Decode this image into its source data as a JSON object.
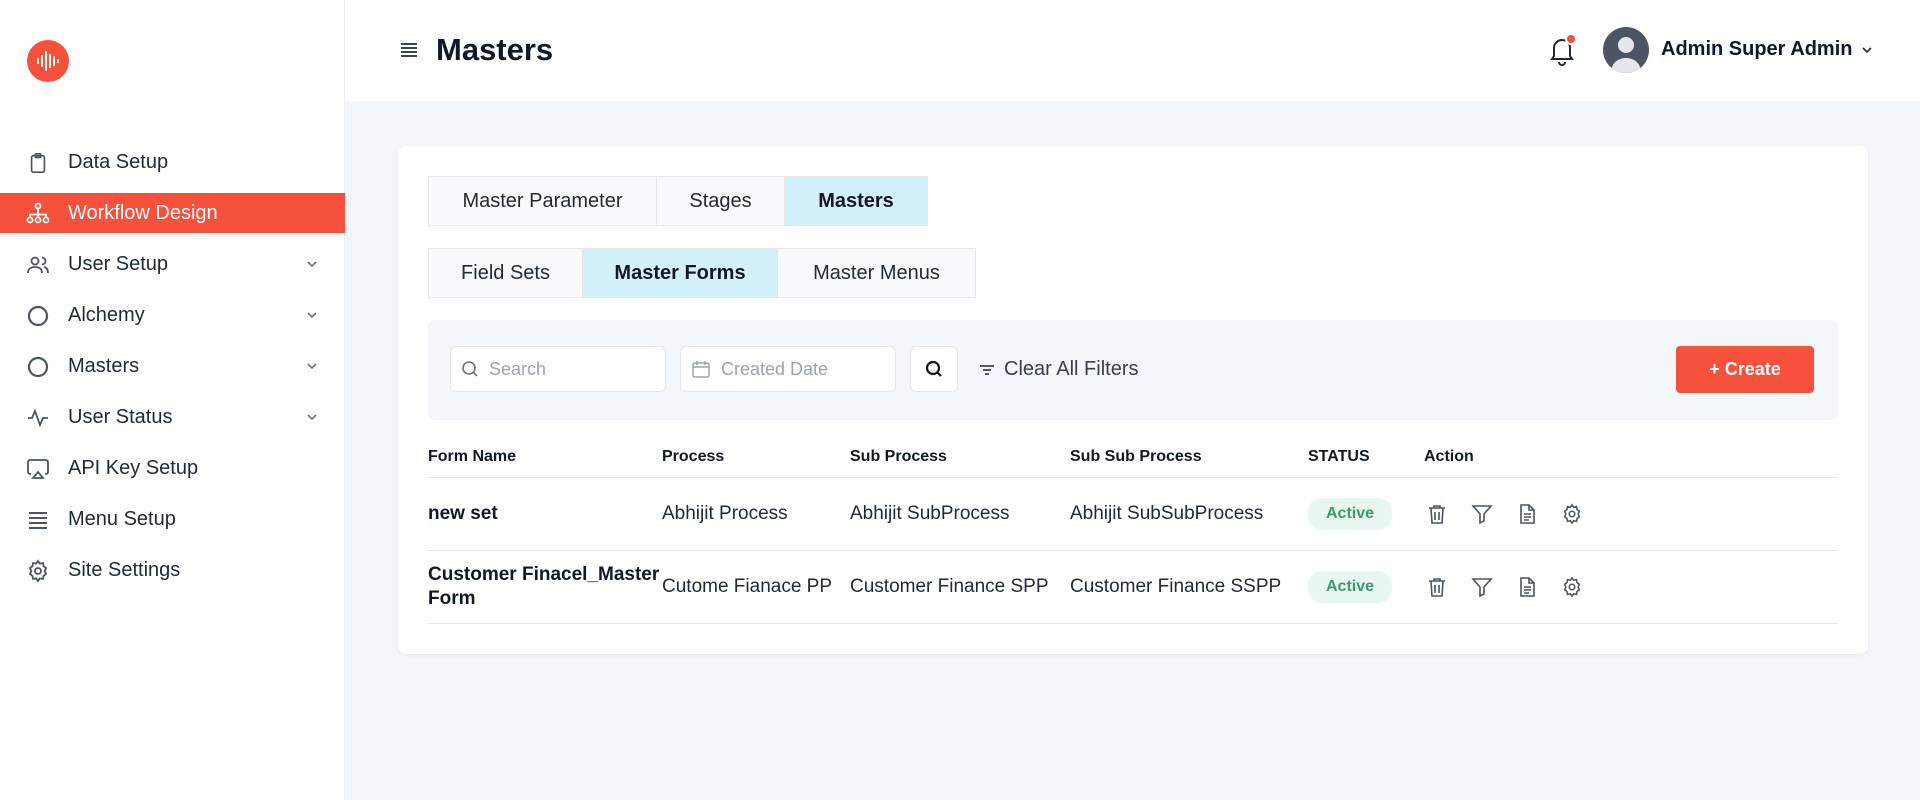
{
  "app": {
    "brand_color": "#f5513d",
    "logo_icon": "audio-wave-icon"
  },
  "sidebar": {
    "items": [
      {
        "label": "Data Setup",
        "icon": "clipboard-icon",
        "has_submenu": false,
        "active": false
      },
      {
        "label": "Workflow Design",
        "icon": "hierarchy-icon",
        "has_submenu": false,
        "active": true
      },
      {
        "label": "User Setup",
        "icon": "users-icon",
        "has_submenu": true,
        "active": false
      },
      {
        "label": "Alchemy",
        "icon": "circle-icon",
        "has_submenu": true,
        "active": false
      },
      {
        "label": "Masters",
        "icon": "circle-icon",
        "has_submenu": true,
        "active": false
      },
      {
        "label": "User Status",
        "icon": "activity-icon",
        "has_submenu": true,
        "active": false
      },
      {
        "label": "API Key Setup",
        "icon": "airplay-icon",
        "has_submenu": false,
        "active": false
      },
      {
        "label": "Menu Setup",
        "icon": "list-icon",
        "has_submenu": false,
        "active": false
      },
      {
        "label": "Site Settings",
        "icon": "gear-icon",
        "has_submenu": false,
        "active": false
      }
    ]
  },
  "header": {
    "title": "Masters",
    "user_name": "Admin Super Admin",
    "has_notification": true
  },
  "tabs_top": [
    {
      "label": "Master Parameter",
      "selected": false
    },
    {
      "label": "Stages",
      "selected": false
    },
    {
      "label": "Masters",
      "selected": true
    }
  ],
  "tabs_sub": [
    {
      "label": "Field Sets",
      "selected": false
    },
    {
      "label": "Master Forms",
      "selected": true
    },
    {
      "label": "Master Menus",
      "selected": false
    }
  ],
  "filters": {
    "search_placeholder": "Search",
    "date_placeholder": "Created Date",
    "clear_label": "Clear All Filters",
    "create_label": "+ Create"
  },
  "table": {
    "columns": [
      "Form Name",
      "Process",
      "Sub Process",
      "Sub Sub Process",
      "STATUS",
      "Action"
    ],
    "rows": [
      {
        "form_name": "new set",
        "process": "Abhijit Process",
        "sub_process": "Abhijit SubProcess",
        "sub_sub_process": "Abhijit SubSubProcess",
        "status": "Active"
      },
      {
        "form_name": "Customer Finacel_Master Form",
        "process": "Cutome Fianace PP",
        "sub_process": "Customer Finance SPP",
        "sub_sub_process": "Customer Finance SSPP",
        "status": "Active"
      }
    ],
    "row_actions": [
      "trash-icon",
      "filter-icon",
      "document-icon",
      "gear-icon"
    ]
  }
}
